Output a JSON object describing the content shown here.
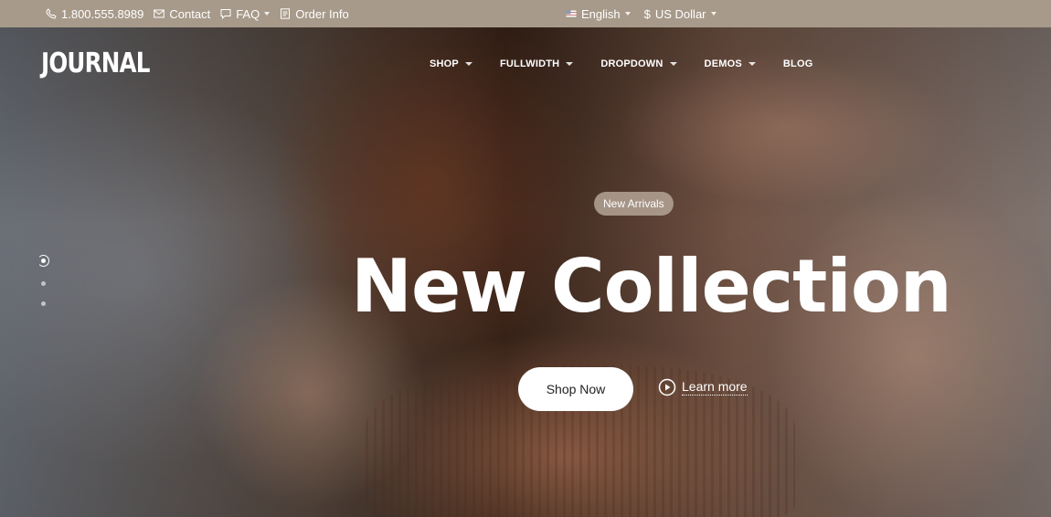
{
  "topbar": {
    "phone": "1.800.555.8989",
    "contact": "Contact",
    "faq": "FAQ",
    "order_info": "Order Info",
    "language": "English",
    "currency_symbol": "$",
    "currency": "US Dollar",
    "icons": [
      "phone-icon",
      "mail-icon",
      "chat-icon",
      "document-icon",
      "flag-icon"
    ]
  },
  "header": {
    "logo": "JOURNAL",
    "nav": [
      {
        "label": "SHOP",
        "dropdown": true
      },
      {
        "label": "FULLWIDTH",
        "dropdown": true
      },
      {
        "label": "DROPDOWN",
        "dropdown": true
      },
      {
        "label": "DEMOS",
        "dropdown": true
      },
      {
        "label": "BLOG",
        "dropdown": false
      }
    ]
  },
  "hero": {
    "badge": "New Arrivals",
    "title": "New Collection",
    "primary_button": "Shop Now",
    "secondary_link": "Learn more",
    "slides_count": 3,
    "active_slide": 1
  },
  "colors": {
    "topbar_bg": "#a79a8a",
    "text": "#ffffff",
    "button_bg": "#ffffff",
    "badge_bg": "#b4a596"
  }
}
